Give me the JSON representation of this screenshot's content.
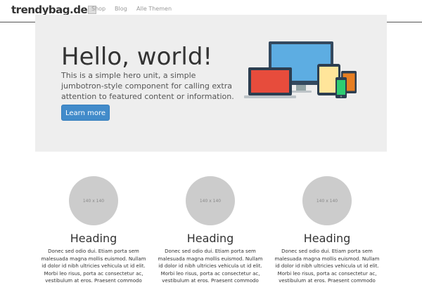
{
  "navbar": {
    "brand": "trendybag.de",
    "links": [
      "Shop",
      "Blog",
      "Alle Themen"
    ]
  },
  "hero": {
    "title": "Hello, world!",
    "text": "This is a simple hero unit, a simple jumbotron-style component for calling extra attention to featured content or information.",
    "button_label": "Learn more",
    "illustration": "devices-illustration"
  },
  "columns": [
    {
      "placeholder": "140 x 140",
      "heading": "Heading",
      "text": "Donec sed odio dui. Etiam porta sem malesuada magna mollis euismod. Nullam id dolor id nibh ultricies vehicula ut id elit. Morbi leo risus, porta ac consectetur ac, vestibulum at eros. Praesent commodo"
    },
    {
      "placeholder": "140 x 140",
      "heading": "Heading",
      "text": "Donec sed odio dui. Etiam porta sem malesuada magna mollis euismod. Nullam id dolor id nibh ultricies vehicula ut id elit. Morbi leo risus, porta ac consectetur ac, vestibulum at eros. Praesent commodo"
    },
    {
      "placeholder": "140 x 140",
      "heading": "Heading",
      "text": "Donec sed odio dui. Etiam porta sem malesuada magna mollis euismod. Nullam id dolor id nibh ultricies vehicula ut id elit. Morbi leo risus, porta ac consectetur ac, vestibulum at eros. Praesent commodo"
    }
  ],
  "colors": {
    "accent": "#428bca",
    "jumbotron_bg": "#eeeeee",
    "placeholder_circle": "#cccccc"
  }
}
